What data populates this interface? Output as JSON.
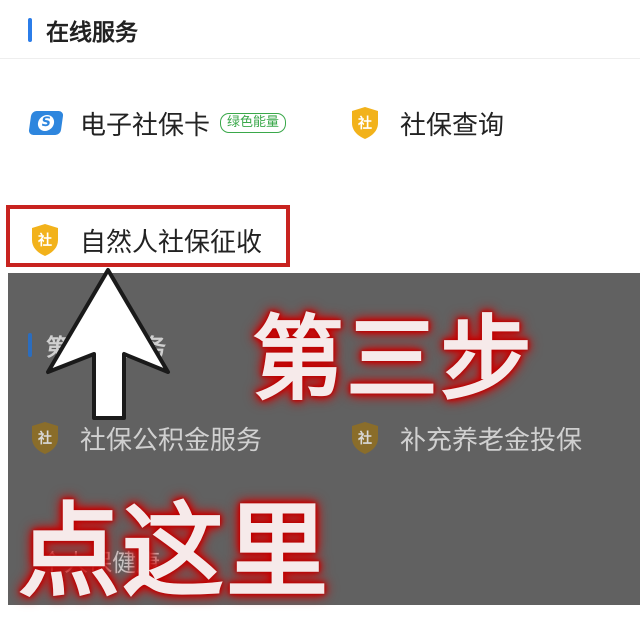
{
  "online_section": {
    "title": "在线服务"
  },
  "services": {
    "e_card": {
      "label": "电子社保卡",
      "badge": "绿色能量",
      "icon": "ss-card-icon"
    },
    "query": {
      "label": "社保查询",
      "icon": "shield-icon"
    },
    "natural_person": {
      "label": "自然人社保征收",
      "icon": "shield-icon"
    }
  },
  "third_party_section": {
    "title_visible": "第三",
    "title_tail": "服务"
  },
  "third_party_services": {
    "fund": {
      "label": "社保公积金服务"
    },
    "pension": {
      "label": "补充养老金投保"
    },
    "partial": {
      "label": "个人保健康"
    }
  },
  "annotation": {
    "step": "第三步",
    "click_here": "点这里"
  },
  "colors": {
    "accent": "#2b7de9",
    "shield": "#f2b21b",
    "highlight": "#c8231f",
    "badge_green": "#3aa84a"
  }
}
